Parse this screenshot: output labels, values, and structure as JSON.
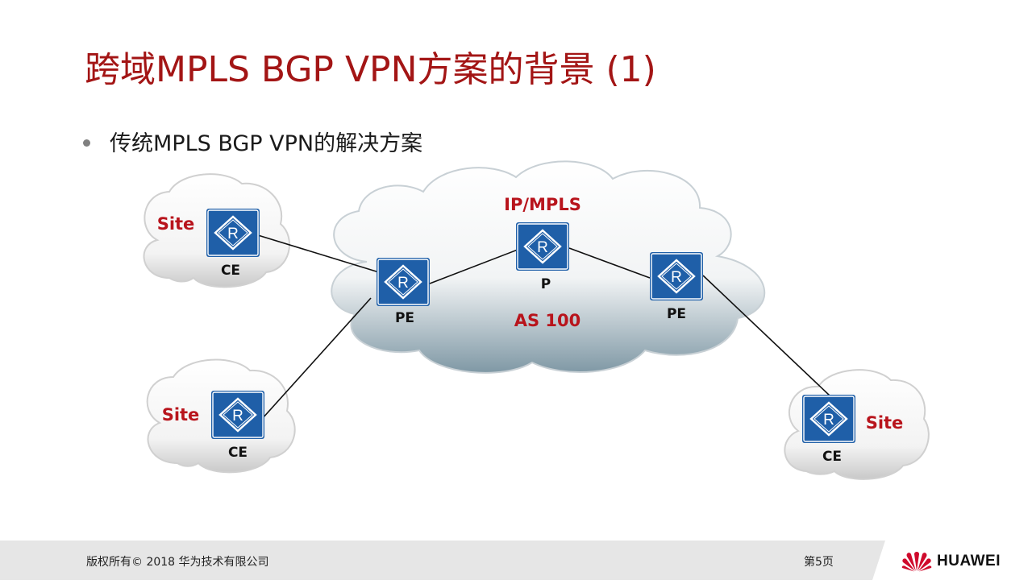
{
  "slide": {
    "title": "跨域MPLS BGP VPN方案的背景 (1)",
    "bullet": "传统MPLS BGP VPN的解决方案"
  },
  "diagram": {
    "backbone_label": "IP/MPLS",
    "as_label": "AS 100",
    "site_label": "Site",
    "nodes": {
      "ce_top_left": {
        "label": "CE",
        "icon": "router-icon",
        "icon_letter": "R"
      },
      "ce_bottom_left": {
        "label": "CE",
        "icon": "router-icon",
        "icon_letter": "R"
      },
      "pe_left": {
        "label": "PE",
        "icon": "router-icon",
        "icon_letter": "R"
      },
      "p_core": {
        "label": "P",
        "icon": "router-icon",
        "icon_letter": "R"
      },
      "pe_right": {
        "label": "PE",
        "icon": "router-icon",
        "icon_letter": "R"
      },
      "ce_right": {
        "label": "CE",
        "icon": "router-icon",
        "icon_letter": "R"
      }
    },
    "links": [
      [
        "ce_top_left",
        "pe_left"
      ],
      [
        "ce_bottom_left",
        "pe_left"
      ],
      [
        "pe_left",
        "p_core"
      ],
      [
        "p_core",
        "pe_right"
      ],
      [
        "pe_right",
        "ce_right"
      ]
    ]
  },
  "footer": {
    "copyright": "版权所有© 2018 华为技术有限公司",
    "page": "第5页",
    "brand": "HUAWEI"
  },
  "colors": {
    "title": "#a31515",
    "accent_red": "#b8141c",
    "router_blue": "#1f5fa8",
    "footer_bg": "#e6e6e6"
  }
}
